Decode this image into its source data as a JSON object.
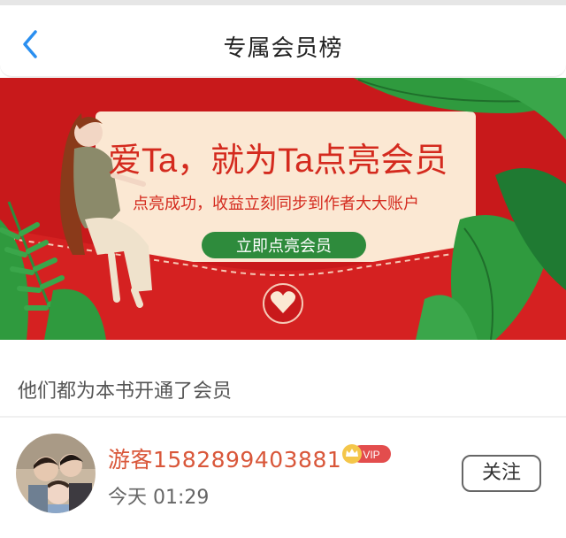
{
  "header": {
    "title": "专属会员榜",
    "back_icon": "chevron-left-icon"
  },
  "banner": {
    "headline": "爱Ta，就为Ta点亮会员",
    "subline": "点亮成功，收益立刻同步到作者大大账户",
    "cta_label": "立即点亮会员",
    "colors": {
      "background": "#c8191b",
      "card": "#fbe8d3",
      "leaf": "#2f9a3e",
      "cta": "#2e8b3c"
    }
  },
  "section": {
    "title": "他们都为本书开通了会员"
  },
  "members": [
    {
      "name": "游客1582899403881",
      "badge": "VIP",
      "time": "今天 01:29",
      "follow_label": "关注"
    }
  ],
  "colors": {
    "accent": "#2a8ff0",
    "name": "#d9573a"
  }
}
